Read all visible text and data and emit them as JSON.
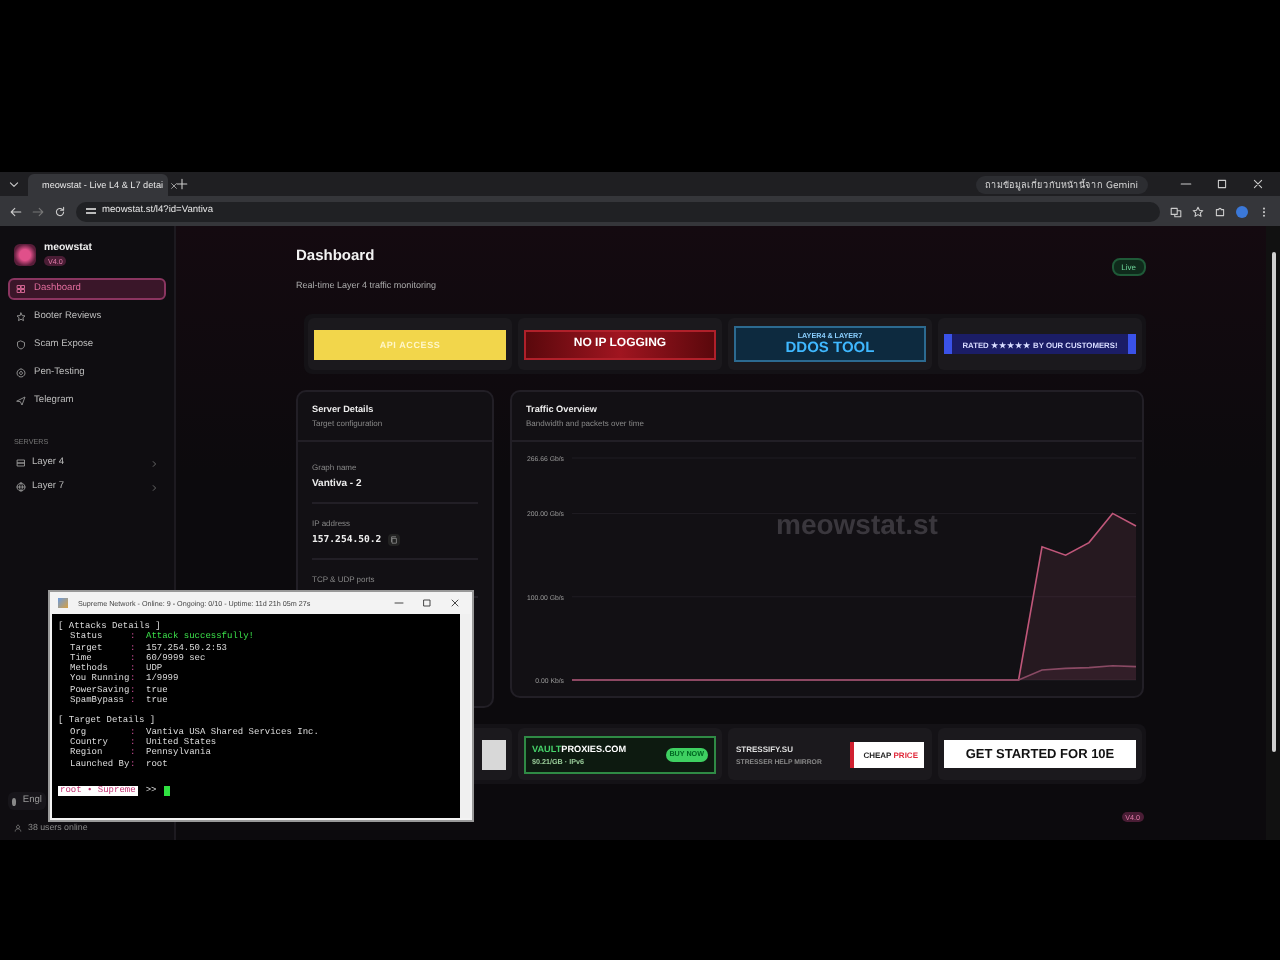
{
  "browser": {
    "tab_title": "meowstat - Live L4 & L7 detai",
    "url": "meowstat.st/l4?id=Vantiva",
    "gemini_button": "ถามข้อมูลเกี่ยวกับหน้านี้จาก Gemini"
  },
  "sidebar": {
    "brand": "meowstat",
    "version": "V4.0",
    "nav": [
      {
        "label": "Dashboard",
        "selected": true
      },
      {
        "label": "Booter Reviews",
        "selected": false
      },
      {
        "label": "Scam Expose",
        "selected": false
      },
      {
        "label": "Pen-Testing",
        "selected": false
      },
      {
        "label": "Telegram",
        "selected": false
      }
    ],
    "section_label": "SERVERS",
    "servers": [
      {
        "label": "Layer 4"
      },
      {
        "label": "Layer 7"
      }
    ],
    "language": "Engl",
    "users_online": "38 users online"
  },
  "header": {
    "title": "Dashboard",
    "subtitle": "Real-time Layer 4 traffic monitoring",
    "status_badge": "Live"
  },
  "banners_top": [
    {
      "kind": "api",
      "text": "API ACCESS"
    },
    {
      "kind": "nologging",
      "text": "NO IP LOGGING"
    },
    {
      "kind": "ddos",
      "line_1": "LAYER4 & LAYER7",
      "line_2": "DDOS TOOL"
    },
    {
      "kind": "rated",
      "text": "RATED ★★★★★ BY OUR CUSTOMERS!"
    }
  ],
  "server_details": {
    "title": "Server Details",
    "subtitle": "Target configuration",
    "fields": [
      {
        "label": "Graph name",
        "value": "Vantiva - 2"
      },
      {
        "label": "IP address",
        "value": "157.254.50.2"
      },
      {
        "label": "TCP & UDP ports"
      }
    ]
  },
  "traffic": {
    "title": "Traffic Overview",
    "subtitle": "Bandwidth and packets over time",
    "watermark": "meowstat.st",
    "chart_data": {
      "type": "area",
      "series": [
        {
          "color": "#c0577a",
          "values": [
            0,
            0,
            0,
            0,
            0,
            0,
            0,
            0,
            0,
            0,
            0,
            0,
            0,
            0,
            0,
            0,
            0,
            0,
            0,
            0,
            160,
            150,
            165,
            200,
            185
          ]
        },
        {
          "color": "#8a4a64",
          "values": [
            0,
            0,
            0,
            0,
            0,
            0,
            0,
            0,
            0,
            0,
            0,
            0,
            0,
            0,
            0,
            0,
            0,
            0,
            0,
            0,
            12,
            14,
            15,
            17,
            16
          ]
        }
      ],
      "ylim": [
        0,
        266.66
      ],
      "yticks": [
        {
          "value": 0,
          "label": "0.00 Kb/s"
        },
        {
          "value": 100,
          "label": "100.00 Gb/s"
        },
        {
          "value": 200,
          "label": "200.00 Gb/s"
        },
        {
          "value": 266.66,
          "label": "266.66 Gb/s"
        }
      ]
    }
  },
  "banners_bottom": [
    {
      "kind": "blank"
    },
    {
      "kind": "vault",
      "brand_a": "VAULT",
      "brand_b": "PROXIES.COM",
      "note": "$0.21/GB · IPv6",
      "button": "BUY NOW"
    },
    {
      "kind": "stressify",
      "brand": "STRESSIFY.SU",
      "tagline": "STRESSER HELP MIRROR",
      "cheap": "CHEAP",
      "price": "PRICE"
    },
    {
      "kind": "started",
      "text": "GET STARTED FOR 10E"
    }
  ],
  "footer_badge": "V4.0",
  "terminal": {
    "title": "Supreme Network - Online: 9 - Ongoing: 0/10 - Uptime: 11d 21h 05m 27s",
    "sections": [
      {
        "heading": "[ Attacks Details ]",
        "rows": [
          {
            "key": "Status",
            "sep": ":",
            "value": "Attack successfully!",
            "kind": "success"
          },
          {
            "key": "Target",
            "sep": ":",
            "value": "157.254.50.2:53",
            "kind": "plain"
          },
          {
            "key": "Time",
            "sep": ":",
            "value": "60/9999 sec",
            "kind": "plain"
          },
          {
            "key": "Methods",
            "sep": ":",
            "value": "UDP",
            "kind": "plain"
          },
          {
            "key": "You Running",
            "sep": ":",
            "value": "1/9999",
            "kind": "plain"
          },
          {
            "key": "PowerSaving",
            "sep": ":",
            "value": "true",
            "kind": "plain"
          },
          {
            "key": "SpamBypass",
            "sep": ":",
            "value": "true",
            "kind": "plain"
          }
        ]
      },
      {
        "heading": "[ Target Details ]",
        "rows": [
          {
            "key": "Org",
            "sep": ":",
            "value": "Vantiva USA Shared Services Inc.",
            "kind": "plain"
          },
          {
            "key": "Country",
            "sep": ":",
            "value": "United States",
            "kind": "plain"
          },
          {
            "key": "Region",
            "sep": ":",
            "value": "Pennsylvania",
            "kind": "plain"
          },
          {
            "key": "Launched By",
            "sep": ":",
            "value": "root",
            "kind": "plain"
          }
        ]
      }
    ],
    "prompt_user": "root • Supreme",
    "prompt_arrow": ">>"
  }
}
